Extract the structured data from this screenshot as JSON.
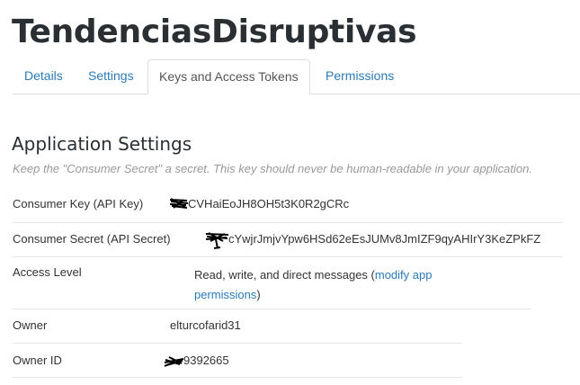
{
  "app": {
    "title": "TendenciasDisruptivas"
  },
  "tabs": [
    {
      "label": "Details",
      "active": false
    },
    {
      "label": "Settings",
      "active": false
    },
    {
      "label": "Keys and Access Tokens",
      "active": true
    },
    {
      "label": "Permissions",
      "active": false
    }
  ],
  "section": {
    "title": "Application Settings",
    "note": "Keep the \"Consumer Secret\" a secret. This key should never be human-readable in your application."
  },
  "settings": {
    "consumer_key": {
      "label": "Consumer Key (API Key)",
      "value": "CVHaiEoJH8OH5t3K0R2gCRc"
    },
    "consumer_secret": {
      "label": "Consumer Secret (API Secret)",
      "value": "cYwjrJmjvYpw6HSd62eEsJUMv8JmIZF9qyAHIrY3KeZPkFZ"
    },
    "access_level": {
      "label": "Access Level",
      "value_prefix": "Read, write, and direct messages (",
      "link_line1": "modify app",
      "link_line2": "permissions",
      "value_suffix": ")"
    },
    "owner": {
      "label": "Owner",
      "value": "elturcofarid31"
    },
    "owner_id": {
      "label": "Owner ID",
      "value": "9392665"
    }
  },
  "colors": {
    "link": "#2b7bb9",
    "title": "#292f33",
    "note": "#999999",
    "redaction": "#000000"
  },
  "icons": [
    "redaction-scribble"
  ]
}
